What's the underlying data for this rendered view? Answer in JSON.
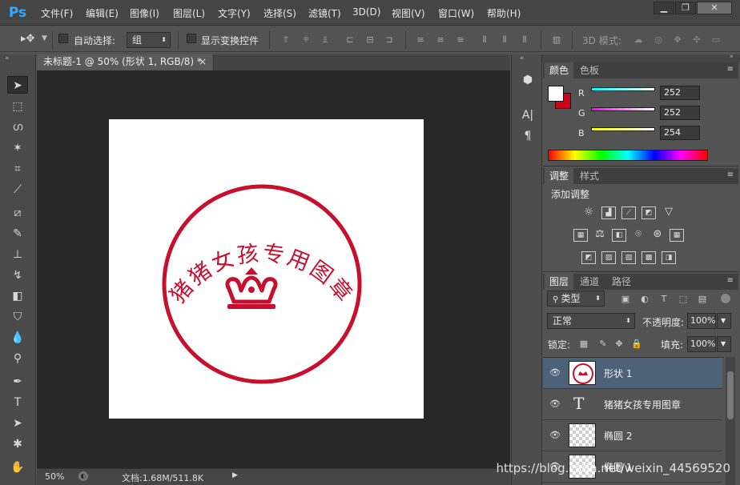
{
  "menubar": {
    "logo": "Ps",
    "items": [
      "文件(F)",
      "编辑(E)",
      "图像(I)",
      "图层(L)",
      "文字(Y)",
      "选择(S)",
      "滤镜(T)",
      "3D(D)",
      "视图(V)",
      "窗口(W)",
      "帮助(H)"
    ],
    "window_buttons": {
      "minimize": "▁",
      "maximize": "❐",
      "close": "✕"
    }
  },
  "options": {
    "auto_select_label": "自动选择:",
    "auto_select_value": "组",
    "show_transform_label": "显示变换控件",
    "mode_label": "3D 模式:"
  },
  "document": {
    "tab_title": "未标题-1 @ 50% (形状 1, RGB/8) *",
    "tab_close": "×",
    "stamp_text": "猪猪女孩专用图章",
    "stamp_color": "#c8102e"
  },
  "status": {
    "zoom": "50%",
    "doc_info": "文档:1.68M/511.8K"
  },
  "color_panel": {
    "tabs": [
      "颜色",
      "色板"
    ],
    "channels": [
      {
        "label": "R",
        "value": "252"
      },
      {
        "label": "G",
        "value": "252"
      },
      {
        "label": "B",
        "value": "254"
      }
    ],
    "foreground": "#fcfcfe",
    "background": "#d0021b"
  },
  "adjust_panel": {
    "tabs": [
      "调整",
      "样式"
    ],
    "heading": "添加调整"
  },
  "layers_panel": {
    "tabs": [
      "图层",
      "通道",
      "路径"
    ],
    "filter_label": "类型",
    "blend_mode": "正常",
    "opacity_label": "不透明度:",
    "opacity_value": "100%",
    "lock_label": "锁定:",
    "fill_label": "填充:",
    "fill_value": "100%",
    "layers": [
      {
        "name": "形状 1",
        "selected": true
      },
      {
        "name": "猪猪女孩专用图章",
        "type": "text",
        "glyph": "T"
      },
      {
        "name": "椭圆 2"
      },
      {
        "name": "椭圆 1"
      }
    ]
  },
  "watermark": "https://blog.csdn.net/weixin_44569520"
}
